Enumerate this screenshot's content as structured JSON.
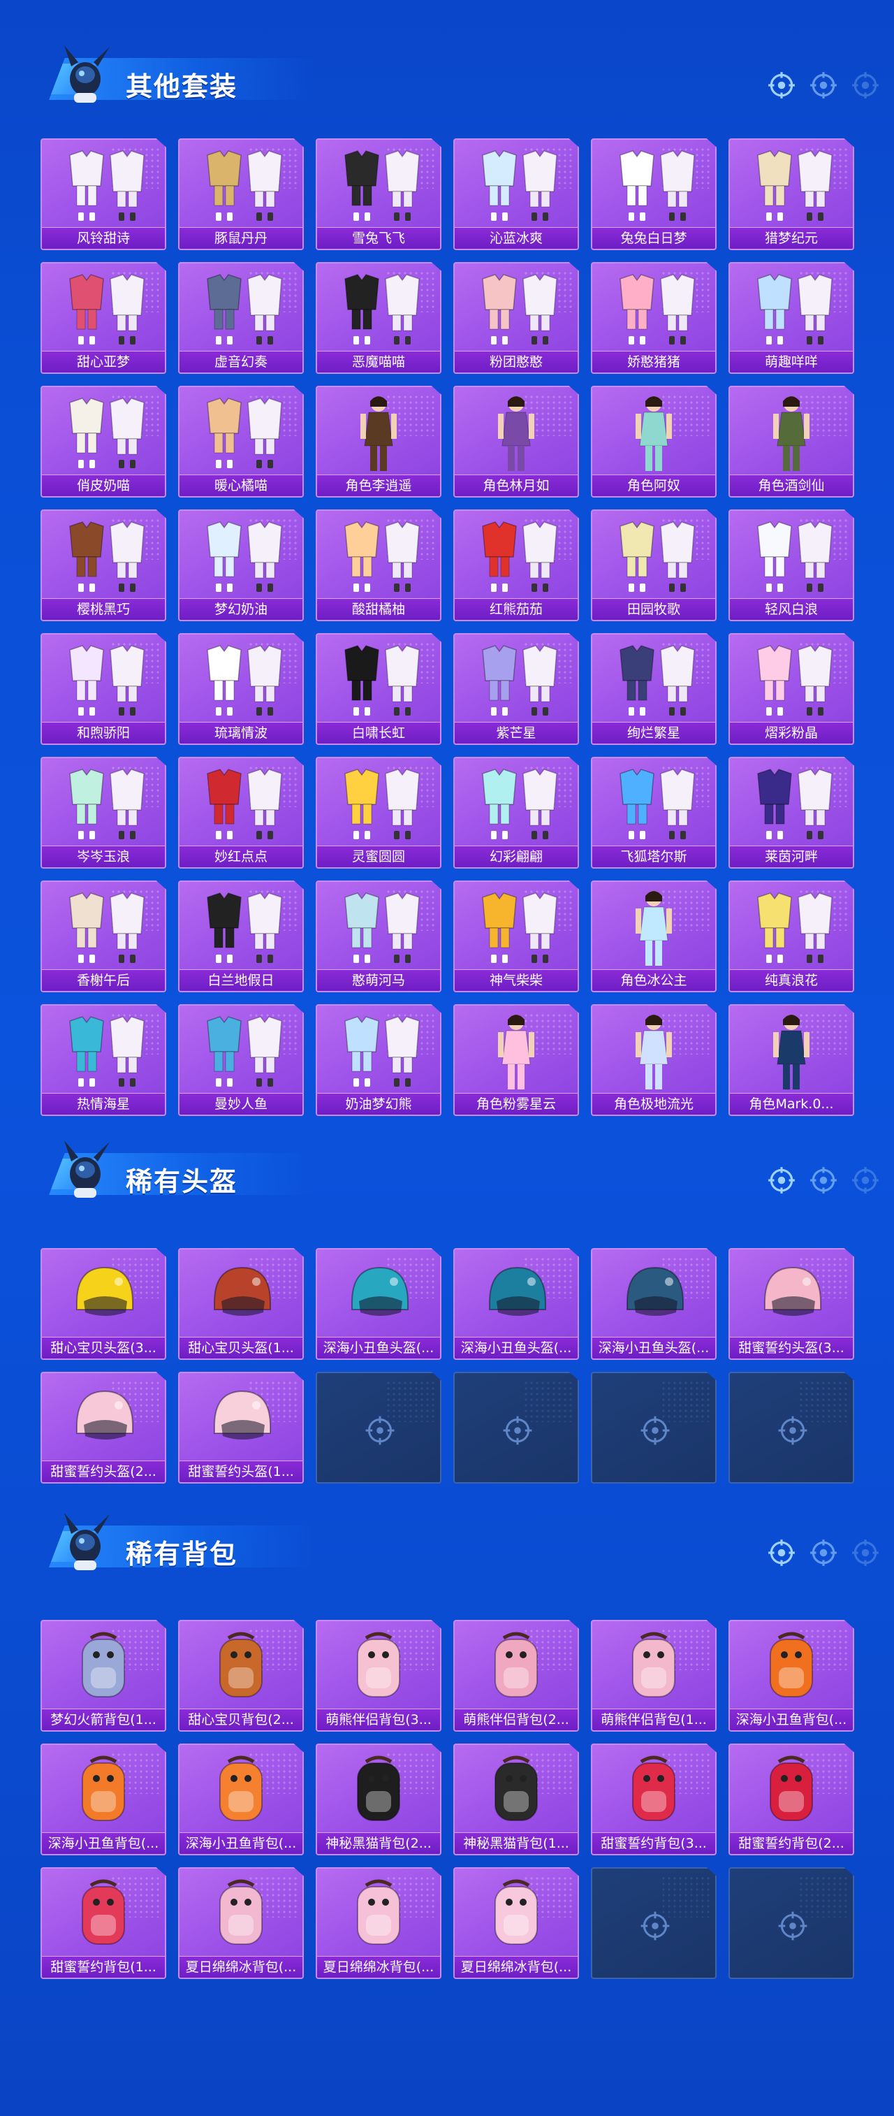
{
  "sections": [
    {
      "title": "其他套装",
      "items": [
        {
          "name": "风铃甜诗",
          "kind": "outfit",
          "color": "#f5f0fa"
        },
        {
          "name": "豚鼠丹丹",
          "kind": "outfit",
          "color": "#d9b46a"
        },
        {
          "name": "雪兔飞飞",
          "kind": "outfit",
          "color": "#2a2a2a"
        },
        {
          "name": "沁蓝冰爽",
          "kind": "outfit",
          "color": "#d5ecff"
        },
        {
          "name": "兔兔白日梦",
          "kind": "outfit",
          "color": "#ffffff"
        },
        {
          "name": "猎梦纪元",
          "kind": "outfit",
          "color": "#f0e0c0"
        },
        {
          "name": "甜心亚梦",
          "kind": "outfit",
          "color": "#e05070"
        },
        {
          "name": "虚音幻奏",
          "kind": "outfit",
          "color": "#5d6c95"
        },
        {
          "name": "恶魔喵喵",
          "kind": "outfit",
          "color": "#222222"
        },
        {
          "name": "粉团憨憨",
          "kind": "outfit",
          "color": "#f6c4c4"
        },
        {
          "name": "娇憨猪猪",
          "kind": "outfit",
          "color": "#ffb0c8"
        },
        {
          "name": "萌趣咩咩",
          "kind": "outfit",
          "color": "#bfe0ff"
        },
        {
          "name": "俏皮奶喵",
          "kind": "outfit",
          "color": "#f5f0e8"
        },
        {
          "name": "暖心橘喵",
          "kind": "outfit",
          "color": "#f0c090"
        },
        {
          "name": "角色李逍遥",
          "kind": "character",
          "color": "#5a3a22"
        },
        {
          "name": "角色林月如",
          "kind": "character",
          "color": "#7a4aa8"
        },
        {
          "name": "角色阿奴",
          "kind": "character",
          "color": "#8fd8cf"
        },
        {
          "name": "角色酒剑仙",
          "kind": "character",
          "color": "#556b3a"
        },
        {
          "name": "樱桃黑巧",
          "kind": "outfit",
          "color": "#8a4a2a"
        },
        {
          "name": "梦幻奶油",
          "kind": "outfit",
          "color": "#e0f0ff"
        },
        {
          "name": "酸甜橘柚",
          "kind": "outfit",
          "color": "#ffcf9a"
        },
        {
          "name": "红熊茄茄",
          "kind": "outfit",
          "color": "#e0322a"
        },
        {
          "name": "田园牧歌",
          "kind": "outfit",
          "color": "#f0e8b0"
        },
        {
          "name": "轻风白浪",
          "kind": "outfit",
          "color": "#f8f8ff"
        },
        {
          "name": "和煦骄阳",
          "kind": "outfit",
          "color": "#f5e6ff"
        },
        {
          "name": "琉璃情波",
          "kind": "outfit",
          "color": "#ffffff"
        },
        {
          "name": "白啸长虹",
          "kind": "outfit",
          "color": "#1a1a1a"
        },
        {
          "name": "紫芒星",
          "kind": "outfit",
          "color": "#a7a0ef"
        },
        {
          "name": "绚烂繁星",
          "kind": "outfit",
          "color": "#3a3f7a"
        },
        {
          "name": "熠彩粉晶",
          "kind": "outfit",
          "color": "#ffcce8"
        },
        {
          "name": "岑岑玉浪",
          "kind": "outfit",
          "color": "#c0f0e0"
        },
        {
          "name": "妙红点点",
          "kind": "outfit",
          "color": "#d02a30"
        },
        {
          "name": "灵蜜圆圆",
          "kind": "outfit",
          "color": "#ffd040"
        },
        {
          "name": "幻彩翩翩",
          "kind": "outfit",
          "color": "#b0f0f0"
        },
        {
          "name": "飞狐塔尔斯",
          "kind": "outfit",
          "color": "#4fb0ff"
        },
        {
          "name": "莱茵河畔",
          "kind": "outfit",
          "color": "#3a2a8a"
        },
        {
          "name": "香榭午后",
          "kind": "outfit",
          "color": "#f0e0d0"
        },
        {
          "name": "白兰地假日",
          "kind": "outfit",
          "color": "#222222"
        },
        {
          "name": "憨萌河马",
          "kind": "outfit",
          "color": "#bfe4ef"
        },
        {
          "name": "神气柴柴",
          "kind": "outfit",
          "color": "#f6b52c"
        },
        {
          "name": "角色冰公主",
          "kind": "character",
          "color": "#c0e8ff"
        },
        {
          "name": "纯真浪花",
          "kind": "outfit",
          "color": "#f5e070"
        },
        {
          "name": "热情海星",
          "kind": "outfit",
          "color": "#3ab8d8"
        },
        {
          "name": "曼妙人鱼",
          "kind": "outfit",
          "color": "#4ab0e0"
        },
        {
          "name": "奶油梦幻熊",
          "kind": "outfit",
          "color": "#bfe0ff"
        },
        {
          "name": "角色粉雾星云",
          "kind": "character",
          "color": "#ffc0e0"
        },
        {
          "name": "角色极地流光",
          "kind": "character",
          "color": "#d0e0ff"
        },
        {
          "name": "角色Mark.0...",
          "kind": "character",
          "color": "#1a3a6a"
        }
      ]
    },
    {
      "title": "稀有头盔",
      "items": [
        {
          "name": "甜心宝贝头盔(3...",
          "kind": "helmet",
          "color": "#f7d21a"
        },
        {
          "name": "甜心宝贝头盔(1...",
          "kind": "helmet",
          "color": "#b8432a"
        },
        {
          "name": "深海小丑鱼头盔(...",
          "kind": "helmet",
          "color": "#27a7c0"
        },
        {
          "name": "深海小丑鱼头盔(...",
          "kind": "helmet",
          "color": "#1d7fa0"
        },
        {
          "name": "深海小丑鱼头盔(...",
          "kind": "helmet",
          "color": "#2a5a80"
        },
        {
          "name": "甜蜜誓约头盔(3...",
          "kind": "helmet",
          "color": "#f4b6c8"
        },
        {
          "name": "甜蜜誓约头盔(2...",
          "kind": "helmet",
          "color": "#f6c8d8"
        },
        {
          "name": "甜蜜誓约头盔(1...",
          "kind": "helmet",
          "color": "#f8d0dc"
        },
        {
          "empty": true
        },
        {
          "empty": true
        },
        {
          "empty": true
        },
        {
          "empty": true
        }
      ]
    },
    {
      "title": "稀有背包",
      "items": [
        {
          "name": "梦幻火箭背包(1...",
          "kind": "backpack",
          "color": "#9aa8d8"
        },
        {
          "name": "甜心宝贝背包(2...",
          "kind": "backpack",
          "color": "#c8682a"
        },
        {
          "name": "萌熊伴侣背包(3...",
          "kind": "backpack",
          "color": "#f6c2d2"
        },
        {
          "name": "萌熊伴侣背包(2...",
          "kind": "backpack",
          "color": "#f0a8c0"
        },
        {
          "name": "萌熊伴侣背包(1...",
          "kind": "backpack",
          "color": "#f4b8cc"
        },
        {
          "name": "深海小丑鱼背包(...",
          "kind": "backpack",
          "color": "#f07020"
        },
        {
          "name": "深海小丑鱼背包(...",
          "kind": "backpack",
          "color": "#f27a28"
        },
        {
          "name": "深海小丑鱼背包(...",
          "kind": "backpack",
          "color": "#f58030"
        },
        {
          "name": "神秘黑猫背包(2...",
          "kind": "backpack",
          "color": "#1e1e1e"
        },
        {
          "name": "神秘黑猫背包(1...",
          "kind": "backpack",
          "color": "#2a2a2a"
        },
        {
          "name": "甜蜜誓约背包(3...",
          "kind": "backpack",
          "color": "#e02a4a"
        },
        {
          "name": "甜蜜誓约背包(2...",
          "kind": "backpack",
          "color": "#d8203e"
        },
        {
          "name": "甜蜜誓约背包(1...",
          "kind": "backpack",
          "color": "#e43a5a"
        },
        {
          "name": "夏日绵绵冰背包(...",
          "kind": "backpack",
          "color": "#f2b8d0"
        },
        {
          "name": "夏日绵绵冰背包(...",
          "kind": "backpack",
          "color": "#f6c0d6"
        },
        {
          "name": "夏日绵绵冰背包(...",
          "kind": "backpack",
          "color": "#f8c8dc"
        },
        {
          "empty": true
        },
        {
          "empty": true
        }
      ]
    }
  ]
}
